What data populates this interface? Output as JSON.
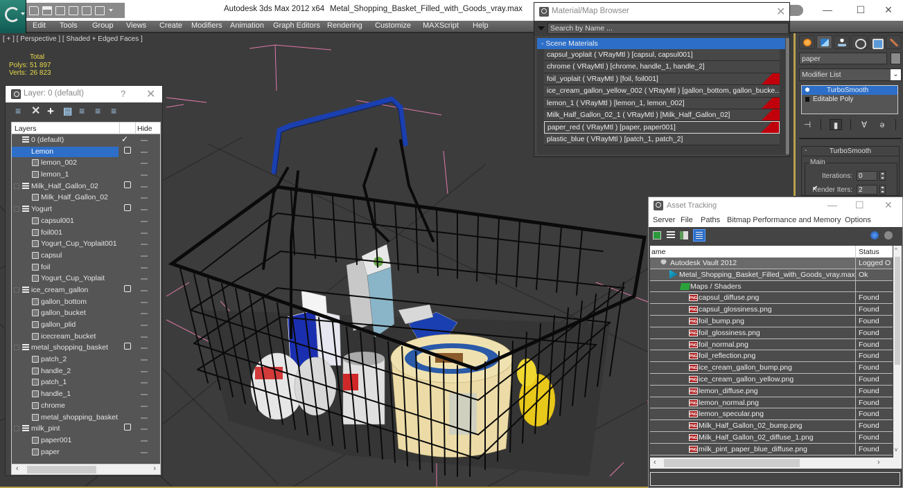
{
  "titlebar": {
    "app_title": "Autodesk 3ds Max  2012 x64",
    "file_title": "Metal_Shopping_Basket_Filled_with_Goods_vray.max",
    "minimize": "—",
    "maximize": "☐",
    "close": "✕"
  },
  "menu": [
    "Edit",
    "Tools",
    "Group",
    "Views",
    "Create",
    "Modifiers",
    "Animation",
    "Graph Editors",
    "Rendering",
    "Customize",
    "MAXScript",
    "Help"
  ],
  "viewport": {
    "label": "[ + ] [ Perspective ] [ Shaded + Edged Faces ]",
    "stats": {
      "header": "Total",
      "polys_label": "Polys:",
      "polys": "51 897",
      "verts_label": "Verts:",
      "verts": "26 823"
    }
  },
  "layer_panel": {
    "title": "Layer: 0 (default)",
    "help": "?",
    "close": "✕",
    "columns": {
      "layers": "Layers",
      "hide": "Hide"
    },
    "rows": [
      {
        "type": "layer",
        "name": "0 (default)",
        "current": true,
        "expander": false
      },
      {
        "type": "layer",
        "name": "Lemon",
        "selected": true,
        "expander": true
      },
      {
        "type": "object",
        "name": "lemon_002"
      },
      {
        "type": "object",
        "name": "lemon_1"
      },
      {
        "type": "layer",
        "name": "Milk_Half_Gallon_02",
        "expander": true
      },
      {
        "type": "object",
        "name": "Milk_Half_Gallon_02"
      },
      {
        "type": "layer",
        "name": "Yogurt",
        "expander": true
      },
      {
        "type": "object",
        "name": "capsul001"
      },
      {
        "type": "object",
        "name": "foil001"
      },
      {
        "type": "object",
        "name": "Yogurt_Cup_Yoplait001"
      },
      {
        "type": "object",
        "name": "capsul"
      },
      {
        "type": "object",
        "name": "foil"
      },
      {
        "type": "object",
        "name": "Yogurt_Cup_Yoplait"
      },
      {
        "type": "layer",
        "name": "ice_cream_gallon",
        "expander": true
      },
      {
        "type": "object",
        "name": "gallon_bottom"
      },
      {
        "type": "object",
        "name": "gallon_bucket"
      },
      {
        "type": "object",
        "name": "gallon_plid"
      },
      {
        "type": "object",
        "name": "icecream_bucket"
      },
      {
        "type": "layer",
        "name": "metal_shopping_basket",
        "expander": true
      },
      {
        "type": "object",
        "name": "patch_2"
      },
      {
        "type": "object",
        "name": "handle_2"
      },
      {
        "type": "object",
        "name": "patch_1"
      },
      {
        "type": "object",
        "name": "handle_1"
      },
      {
        "type": "object",
        "name": "chrome"
      },
      {
        "type": "object",
        "name": "metal_shopping_basket"
      },
      {
        "type": "layer",
        "name": "milk_pint",
        "expander": true
      },
      {
        "type": "object",
        "name": "paper001"
      },
      {
        "type": "object",
        "name": "paper"
      }
    ]
  },
  "material_browser": {
    "title": "Material/Map Browser",
    "close": "✕",
    "search_placeholder": "Search by Name ...",
    "group": "- Scene Materials",
    "items": [
      {
        "label": "capsul_yoplait  ( VRayMtl ) [capsul, capsul001]",
        "flag": false
      },
      {
        "label": "chrome  ( VRayMtl ) [chrome, handle_1, handle_2]",
        "flag": false
      },
      {
        "label": "foil_yoplait  ( VRayMtl ) [foil, foil001]",
        "flag": true
      },
      {
        "label": "ice_cream_gallon_yellow_002  ( VRayMtl ) [gallon_bottom, gallon_bucke...",
        "flag": false
      },
      {
        "label": "lemon_1  ( VRayMtl ) [lemon_1, lemon_002]",
        "flag": true
      },
      {
        "label": "Milk_Half_Gallon_02_1  ( VRayMtl ) [Milk_Half_Gallon_02]",
        "flag": true
      },
      {
        "label": "paper_red  ( VRayMtl ) [paper, paper001]",
        "flag": true,
        "selected": true
      },
      {
        "label": "plastic_blue  ( VRayMtl ) [patch_1, patch_2]",
        "flag": false
      }
    ]
  },
  "command_panel": {
    "tabs": [
      "create",
      "modify",
      "hierarchy",
      "motion",
      "display",
      "utilities"
    ],
    "object_name": "paper",
    "modifier_list": "Modifier List",
    "stack": [
      {
        "name": "TurboSmooth",
        "selected": true
      },
      {
        "name": "Editable Poly",
        "selected": false
      }
    ],
    "rollout": {
      "collapse": "-",
      "title": "TurboSmooth",
      "group": "Main",
      "iterations_label": "Iterations:",
      "iterations": "0",
      "render_iters_label": "Render Iters:",
      "render_iters": "2",
      "render_iters_checked": true
    }
  },
  "asset_tracking": {
    "title": "Asset Tracking",
    "minimize": "—",
    "maximize": "☐",
    "close": "✕",
    "menu": [
      "Server",
      "File",
      "Paths",
      "Bitmap Performance and Memory",
      "Options"
    ],
    "columns": {
      "name": "ame",
      "status": "Status"
    },
    "rows": [
      {
        "kind": "vault",
        "name": "Autodesk Vault 2012",
        "status": "Logged O"
      },
      {
        "kind": "file",
        "name": "Metal_Shopping_Basket_Filled_with_Goods_vray.max",
        "status": "Ok"
      },
      {
        "kind": "maps",
        "name": "Maps / Shaders",
        "status": ""
      },
      {
        "kind": "png",
        "name": "capsul_diffuse.png",
        "status": "Found"
      },
      {
        "kind": "png",
        "name": "capsul_glossiness.png",
        "status": "Found"
      },
      {
        "kind": "png",
        "name": "foil_bump.png",
        "status": "Found"
      },
      {
        "kind": "png",
        "name": "foil_glossiness.png",
        "status": "Found"
      },
      {
        "kind": "png",
        "name": "foil_normal.png",
        "status": "Found"
      },
      {
        "kind": "png",
        "name": "foil_reflection.png",
        "status": "Found"
      },
      {
        "kind": "png",
        "name": "ice_cream_gallon_bump.png",
        "status": "Found"
      },
      {
        "kind": "png",
        "name": "ice_cream_gallon_yellow.png",
        "status": "Found"
      },
      {
        "kind": "png",
        "name": "lemon_diffuse.png",
        "status": "Found"
      },
      {
        "kind": "png",
        "name": "lemon_normal.png",
        "status": "Found"
      },
      {
        "kind": "png",
        "name": "lemon_specular.png",
        "status": "Found"
      },
      {
        "kind": "png",
        "name": "Milk_Half_Gallon_02_bump.png",
        "status": "Found"
      },
      {
        "kind": "png",
        "name": "Milk_Half_Gallon_02_diffuse_1.png",
        "status": "Found"
      },
      {
        "kind": "png",
        "name": "milk_pint_paper_blue_diffuse.png",
        "status": "Found"
      }
    ]
  },
  "colors": {
    "selection_blue": "#2d6fc8",
    "stats_yellow": "#e6d84a",
    "viewport_bg": "#3c3c3c",
    "handle_blue": "#1a3fb0",
    "material_flag_red": "#c0000a",
    "bbox_pink": "#e07aa8"
  }
}
